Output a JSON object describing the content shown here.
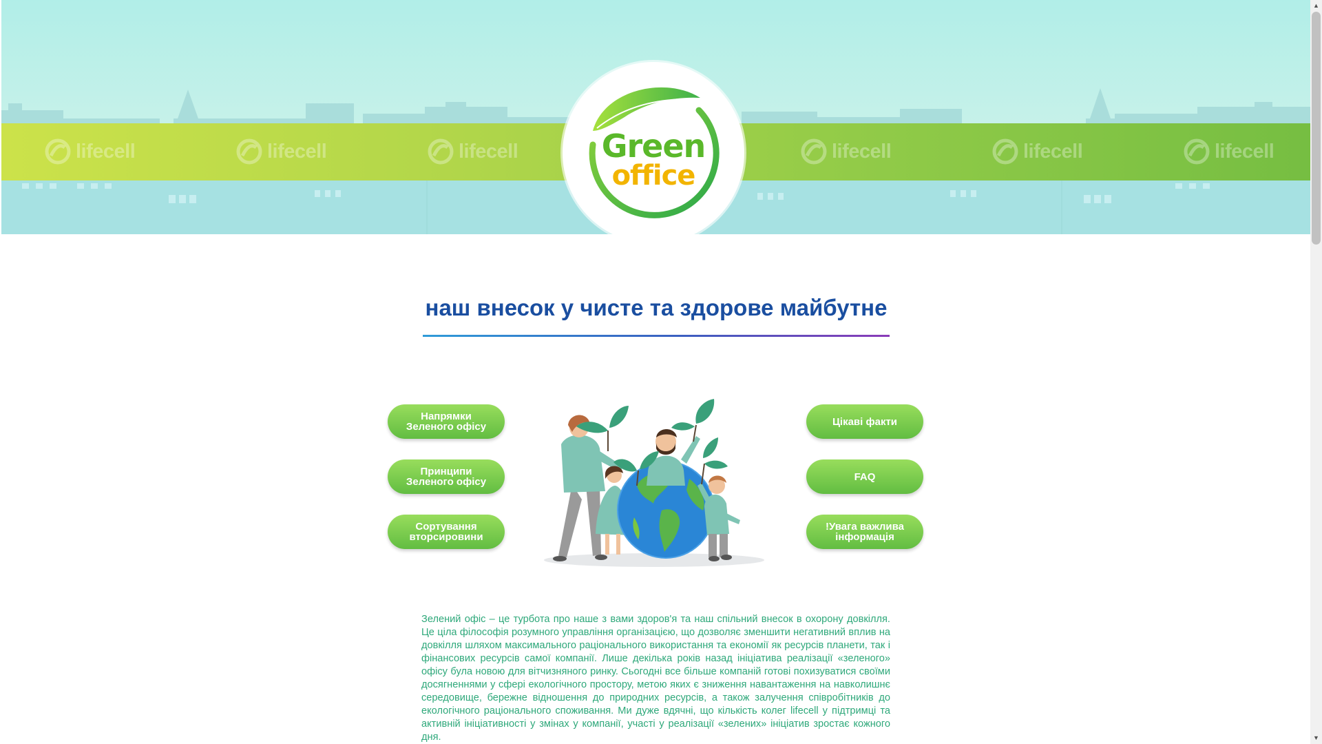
{
  "header": {
    "brand_stripe_text": "lifecell",
    "logo": {
      "line1": "Green",
      "line2": "office"
    }
  },
  "heading": "наш внесок у чисте та здорове майбутне",
  "nav": {
    "left": [
      {
        "label": "Напрямки\nЗеленого офісу"
      },
      {
        "label": "Принципи\nЗеленого офісу"
      },
      {
        "label": "Сортування\nвторсировини"
      }
    ],
    "right": [
      {
        "label": "Цікаві факти"
      },
      {
        "label": "FAQ"
      },
      {
        "label": "!Увага важлива\nінформація"
      }
    ]
  },
  "intro_text": "Зелений офіс – це турбота про наше з вами здоров'я та наш спільний внесок в охорону довкілля. Це ціла філософія розумного управління організацією, що дозволяє зменшити негативний вплив на довкілля шляхом максимального раціонального використання та економії як ресурсів планети, так і фінансових ресурсів самої компанії. Лише декілька років назад ініціатива реалізації «зеленого» офісу була новою для вітчизняного ринку. Сьогодні все більше компаній готові похизуватися своїми досягненнями у сфері екологічного простору, метою яких є зниження навантаження на навколишнє середовище, бережне відношення до природних ресурсів, а також залучення співробітників до екологічного раціонального споживання. Ми дуже вдячні, що кількість колег lifecell у підтримці та активній ініціативності у змінах у компанії, участі у реалізації «зелених» ініціатив зростає кожного дня.",
  "colors": {
    "heading": "#1a4ea0",
    "button": "#76c84a",
    "text": "#2ea87a",
    "stripe_left": "#c8e24a",
    "stripe_right": "#7ec245"
  }
}
